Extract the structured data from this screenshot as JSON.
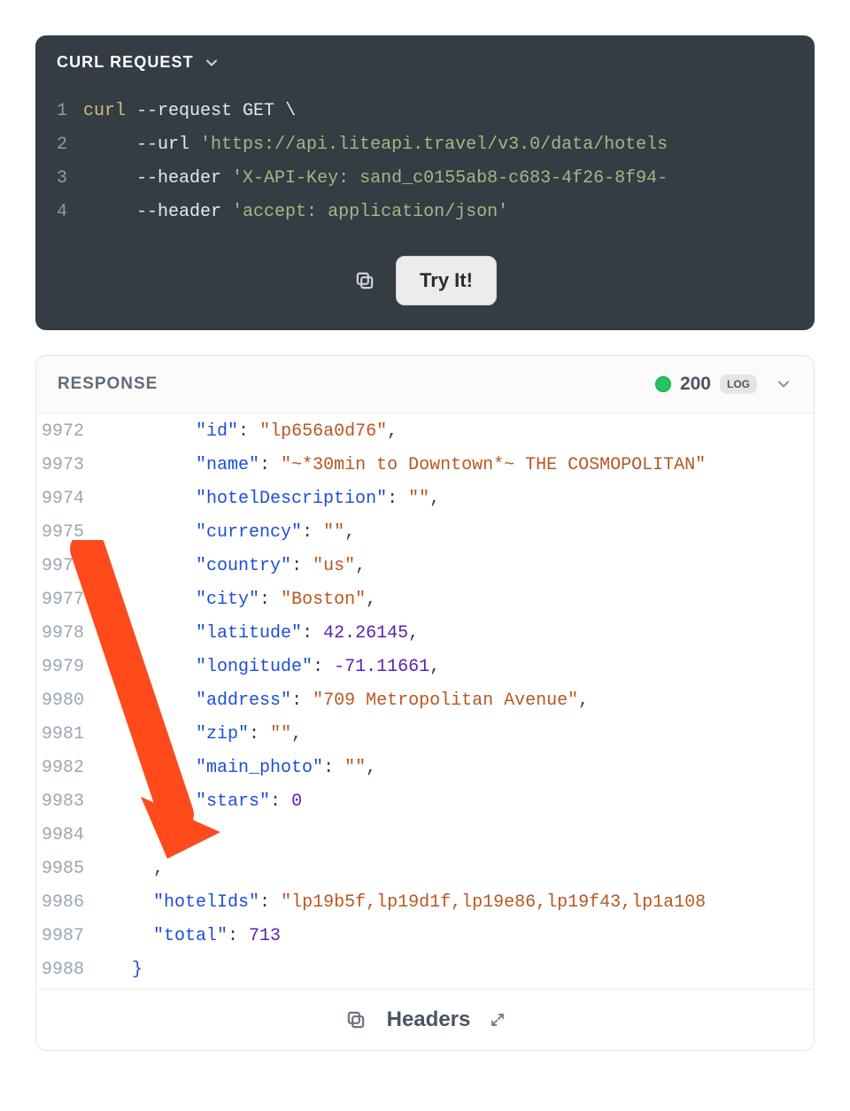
{
  "request": {
    "header_label": "CURL REQUEST",
    "lines": [
      {
        "n": "1",
        "tokens": [
          {
            "cls": "tok-cmd",
            "t": "curl "
          },
          {
            "cls": "tok-flag",
            "t": "--request "
          },
          {
            "cls": "tok-method",
            "t": "GET "
          },
          {
            "cls": "tok-punct",
            "t": "\\"
          }
        ]
      },
      {
        "n": "2",
        "tokens": [
          {
            "cls": "tok-white",
            "t": "     "
          },
          {
            "cls": "tok-flag",
            "t": "--url "
          },
          {
            "cls": "tok-str",
            "t": "'https://api.liteapi.travel/v3.0/data/hotels"
          }
        ]
      },
      {
        "n": "3",
        "tokens": [
          {
            "cls": "tok-white",
            "t": "     "
          },
          {
            "cls": "tok-flag",
            "t": "--header "
          },
          {
            "cls": "tok-str",
            "t": "'X-API-Key: sand_c0155ab8-c683-4f26-8f94-"
          }
        ]
      },
      {
        "n": "4",
        "tokens": [
          {
            "cls": "tok-white",
            "t": "     "
          },
          {
            "cls": "tok-flag",
            "t": "--header "
          },
          {
            "cls": "tok-str",
            "t": "'accept: application/json'"
          }
        ]
      }
    ],
    "try_label": "Try It!"
  },
  "response": {
    "header_label": "RESPONSE",
    "status_code": "200",
    "log_label": "LOG",
    "footer_label": "Headers",
    "lines": [
      {
        "n": "9972",
        "tokens": [
          {
            "cls": "",
            "t": "         "
          },
          {
            "cls": "tok-key",
            "t": "\"id\""
          },
          {
            "cls": "tok-colon",
            "t": ": "
          },
          {
            "cls": "tok-jstr",
            "t": "\"lp656a0d76\""
          },
          {
            "cls": "tok-colon",
            "t": ","
          }
        ]
      },
      {
        "n": "9973",
        "tokens": [
          {
            "cls": "",
            "t": "         "
          },
          {
            "cls": "tok-key",
            "t": "\"name\""
          },
          {
            "cls": "tok-colon",
            "t": ": "
          },
          {
            "cls": "tok-jstr",
            "t": "\"~*30min to Downtown*~ THE COSMOPOLITAN\""
          }
        ]
      },
      {
        "n": "9974",
        "tokens": [
          {
            "cls": "",
            "t": "         "
          },
          {
            "cls": "tok-key",
            "t": "\"hotelDescription\""
          },
          {
            "cls": "tok-colon",
            "t": ": "
          },
          {
            "cls": "tok-jstr",
            "t": "\"\""
          },
          {
            "cls": "tok-colon",
            "t": ","
          }
        ]
      },
      {
        "n": "9975",
        "tokens": [
          {
            "cls": "",
            "t": "         "
          },
          {
            "cls": "tok-key",
            "t": "\"currency\""
          },
          {
            "cls": "tok-colon",
            "t": ": "
          },
          {
            "cls": "tok-jstr",
            "t": "\"\""
          },
          {
            "cls": "tok-colon",
            "t": ","
          }
        ]
      },
      {
        "n": "9976",
        "tokens": [
          {
            "cls": "",
            "t": "         "
          },
          {
            "cls": "tok-key",
            "t": "\"country\""
          },
          {
            "cls": "tok-colon",
            "t": ": "
          },
          {
            "cls": "tok-jstr",
            "t": "\"us\""
          },
          {
            "cls": "tok-colon",
            "t": ","
          }
        ]
      },
      {
        "n": "9977",
        "tokens": [
          {
            "cls": "",
            "t": "         "
          },
          {
            "cls": "tok-key",
            "t": "\"city\""
          },
          {
            "cls": "tok-colon",
            "t": ": "
          },
          {
            "cls": "tok-jstr",
            "t": "\"Boston\""
          },
          {
            "cls": "tok-colon",
            "t": ","
          }
        ]
      },
      {
        "n": "9978",
        "tokens": [
          {
            "cls": "",
            "t": "         "
          },
          {
            "cls": "tok-key",
            "t": "\"latitude\""
          },
          {
            "cls": "tok-colon",
            "t": ": "
          },
          {
            "cls": "tok-num",
            "t": "42.26145"
          },
          {
            "cls": "tok-colon",
            "t": ","
          }
        ]
      },
      {
        "n": "9979",
        "tokens": [
          {
            "cls": "",
            "t": "         "
          },
          {
            "cls": "tok-key",
            "t": "\"longitude\""
          },
          {
            "cls": "tok-colon",
            "t": ": "
          },
          {
            "cls": "tok-num",
            "t": "-71.11661"
          },
          {
            "cls": "tok-colon",
            "t": ","
          }
        ]
      },
      {
        "n": "9980",
        "tokens": [
          {
            "cls": "",
            "t": "         "
          },
          {
            "cls": "tok-key",
            "t": "\"address\""
          },
          {
            "cls": "tok-colon",
            "t": ": "
          },
          {
            "cls": "tok-jstr",
            "t": "\"709 Metropolitan Avenue\""
          },
          {
            "cls": "tok-colon",
            "t": ","
          }
        ]
      },
      {
        "n": "9981",
        "tokens": [
          {
            "cls": "",
            "t": "         "
          },
          {
            "cls": "tok-key",
            "t": "\"zip\""
          },
          {
            "cls": "tok-colon",
            "t": ": "
          },
          {
            "cls": "tok-jstr",
            "t": "\"\""
          },
          {
            "cls": "tok-colon",
            "t": ","
          }
        ]
      },
      {
        "n": "9982",
        "tokens": [
          {
            "cls": "",
            "t": "         "
          },
          {
            "cls": "tok-key",
            "t": "\"main_photo\""
          },
          {
            "cls": "tok-colon",
            "t": ": "
          },
          {
            "cls": "tok-jstr",
            "t": "\"\""
          },
          {
            "cls": "tok-colon",
            "t": ","
          }
        ]
      },
      {
        "n": "9983",
        "tokens": [
          {
            "cls": "",
            "t": "         "
          },
          {
            "cls": "tok-key",
            "t": "\"stars\""
          },
          {
            "cls": "tok-colon",
            "t": ": "
          },
          {
            "cls": "tok-num",
            "t": "0"
          }
        ]
      },
      {
        "n": "9984",
        "tokens": [
          {
            "cls": "",
            "t": "       "
          },
          {
            "cls": "tok-brace",
            "t": "}"
          }
        ]
      },
      {
        "n": "9985",
        "tokens": [
          {
            "cls": "",
            "t": "     "
          },
          {
            "cls": "tok-colon",
            "t": ","
          }
        ]
      },
      {
        "n": "9986",
        "tokens": [
          {
            "cls": "",
            "t": "     "
          },
          {
            "cls": "tok-key",
            "t": "\"hotelIds\""
          },
          {
            "cls": "tok-colon",
            "t": ": "
          },
          {
            "cls": "tok-jstr",
            "t": "\"lp19b5f,lp19d1f,lp19e86,lp19f43,lp1a108"
          }
        ]
      },
      {
        "n": "9987",
        "tokens": [
          {
            "cls": "",
            "t": "     "
          },
          {
            "cls": "tok-key",
            "t": "\"total\""
          },
          {
            "cls": "tok-colon",
            "t": ": "
          },
          {
            "cls": "tok-num",
            "t": "713"
          }
        ]
      },
      {
        "n": "9988",
        "tokens": [
          {
            "cls": "",
            "t": "   "
          },
          {
            "cls": "tok-brace",
            "t": "}"
          }
        ]
      }
    ]
  }
}
